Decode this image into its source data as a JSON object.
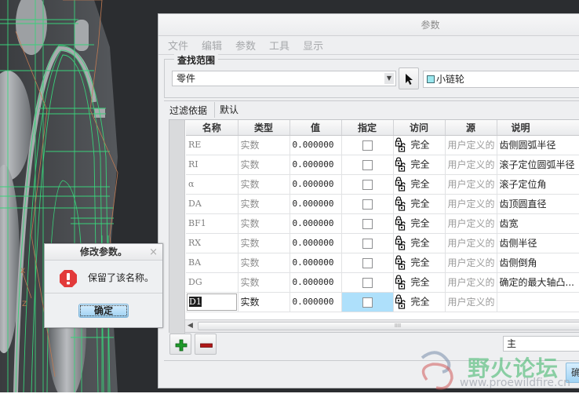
{
  "viewport": {
    "description": "3D sprocket model wireframe"
  },
  "dialog": {
    "title": "参数",
    "menu": [
      "文件",
      "编辑",
      "参数",
      "工具",
      "显示"
    ],
    "scope": {
      "legend": "查找范围",
      "selected": "零件",
      "model_name": "小链轮"
    },
    "filter": {
      "label": "过滤依据",
      "value": "默认"
    },
    "table": {
      "columns": [
        "名称",
        "类型",
        "值",
        "指定",
        "访问",
        "源",
        "说明"
      ],
      "rows": [
        {
          "name": "RE",
          "type": "实数",
          "value": "0.000000",
          "designated": false,
          "access": "完全",
          "source": "用户定义的",
          "description": "齿侧圆弧半径"
        },
        {
          "name": "RI",
          "type": "实数",
          "value": "0.000000",
          "designated": false,
          "access": "完全",
          "source": "用户定义的",
          "description": "滚子定位圆弧半径"
        },
        {
          "name": "α",
          "type": "实数",
          "value": "0.000000",
          "designated": false,
          "access": "完全",
          "source": "用户定义的",
          "description": "滚子定位角"
        },
        {
          "name": "DA",
          "type": "实数",
          "value": "0.000000",
          "designated": false,
          "access": "完全",
          "source": "用户定义的",
          "description": "齿顶圆直径"
        },
        {
          "name": "BF1",
          "type": "实数",
          "value": "0.000000",
          "designated": false,
          "access": "完全",
          "source": "用户定义的",
          "description": "齿宽"
        },
        {
          "name": "RX",
          "type": "实数",
          "value": "0.000000",
          "designated": false,
          "access": "完全",
          "source": "用户定义的",
          "description": "齿侧半径"
        },
        {
          "name": "BA",
          "type": "实数",
          "value": "0.000000",
          "designated": false,
          "access": "完全",
          "source": "用户定义的",
          "description": "齿侧倒角"
        },
        {
          "name": "DG",
          "type": "实数",
          "value": "0.000000",
          "designated": false,
          "access": "完全",
          "source": "用户定义的",
          "description": "确定的最大轴凸..."
        },
        {
          "name": "D1",
          "type": "实数",
          "value": "0.000000",
          "designated": false,
          "access": "完全",
          "source": "用户定义的",
          "description": ""
        }
      ],
      "scroll_grip": "IIII"
    },
    "add_icon": "plus-icon",
    "remove_icon": "minus-icon",
    "main_field": "主",
    "ok_label": "确"
  },
  "message_box": {
    "title": "修改参数。",
    "close_glyph": "×",
    "icon": "error-icon",
    "message": "保留了该名称。",
    "ok_label": "确定"
  },
  "watermark": {
    "title": "野火论坛",
    "url": "www.proewildfire.cn"
  }
}
